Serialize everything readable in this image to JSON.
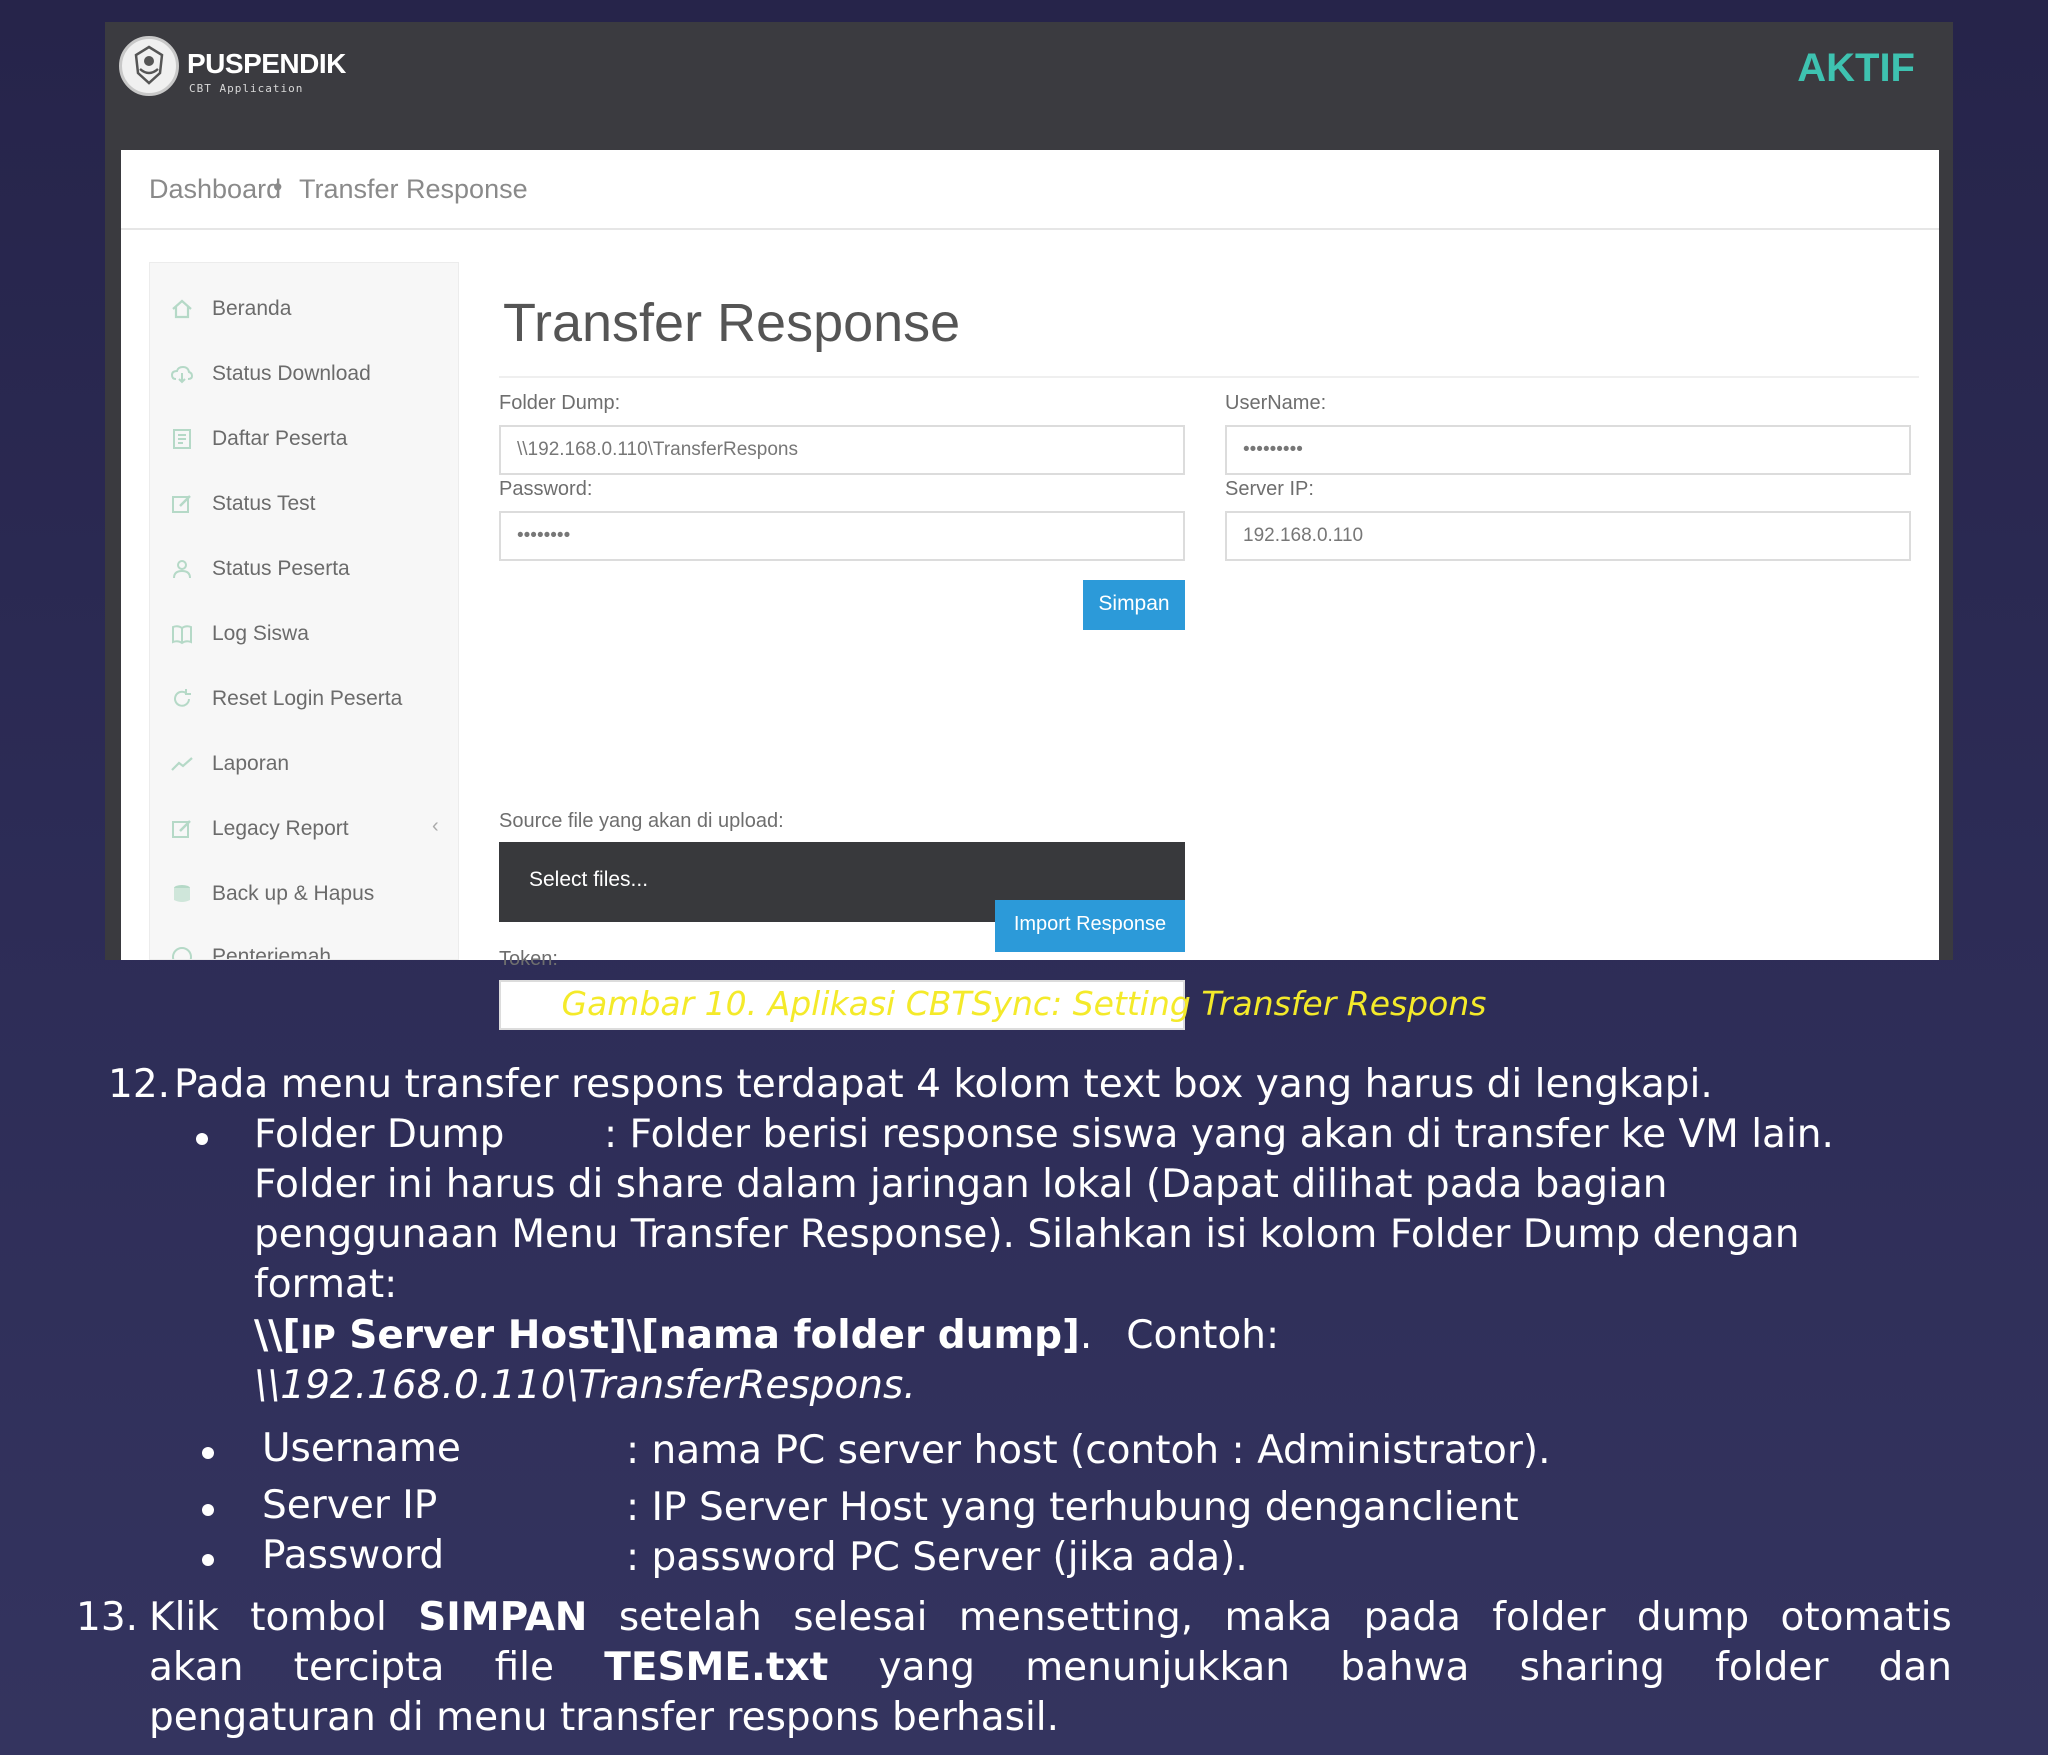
{
  "app": {
    "brand": "PUSPENDIK",
    "brand_sub": "CBT Application",
    "status": "AKTIF"
  },
  "breadcrumb": {
    "items": [
      "Dashboard",
      "Transfer Response"
    ],
    "separator": "•"
  },
  "sidebar": {
    "items": [
      {
        "label": "Beranda",
        "icon": "home-icon"
      },
      {
        "label": "Status Download",
        "icon": "cloud-download-icon"
      },
      {
        "label": "Daftar Peserta",
        "icon": "list-icon"
      },
      {
        "label": "Status Test",
        "icon": "edit-icon"
      },
      {
        "label": "Status Peserta",
        "icon": "user-icon"
      },
      {
        "label": "Log Siswa",
        "icon": "book-icon"
      },
      {
        "label": "Reset Login Peserta",
        "icon": "refresh-icon"
      },
      {
        "label": "Laporan",
        "icon": "chart-line-icon"
      },
      {
        "label": "Legacy Report",
        "icon": "edit-icon",
        "chevron": "‹"
      },
      {
        "label": "Back up & Hapus",
        "icon": "database-icon"
      },
      {
        "label": "Penterjemah",
        "icon": "globe-icon"
      }
    ]
  },
  "form": {
    "title": "Transfer Response",
    "folder_dump": {
      "label": "Folder Dump:",
      "value": "\\\\192.168.0.110\\TransferRespons"
    },
    "password": {
      "label": "Password:",
      "value": "••••••••"
    },
    "username": {
      "label": "UserName:",
      "value": "•••••••••"
    },
    "server_ip": {
      "label": "Server IP:",
      "value": "192.168.0.110"
    },
    "simpan": "Simpan",
    "source_label": "Source file yang akan di upload:",
    "select_files": "Select files...",
    "token": {
      "label": "Token:",
      "value": ""
    },
    "import": "Import Response"
  },
  "caption": "Gambar 10. Aplikasi CBTSync: Setting Transfer Respons",
  "doc": {
    "item12": {
      "num": "12.",
      "text": "Pada menu transfer respons terdapat 4 kolom text box yang harus di  lengkapi."
    },
    "folder": {
      "term": "Folder Dump",
      "desc": ": Folder berisi response siswa yang akan di  transfer ke VM lain.",
      "line2": "Folder ini harus di share dalam jaringan lokal  (Dapat dilihat pada bagian",
      "line3": "penggunaan Menu Transfer Response).  Silahkan isi kolom Folder Dump dengan",
      "line4": "format:",
      "fmt_pre": "\\\\[",
      "fmt_ip": "IP",
      "fmt_rest": " Server Host]\\[nama folder dump]",
      "fmt_dot": ".",
      "contoh": "Contoh:",
      "example": "\\\\192.168.0.110\\TransferRespons."
    },
    "username": {
      "term": "Username",
      "desc": ": nama PC server host (contoh : Administrator)."
    },
    "serverip": {
      "term": "Server IP",
      "desc": ": IP Server Host yang terhubung denganclient"
    },
    "password": {
      "term": "Password",
      "desc": ": password PC Server (jika ada)."
    },
    "item13": {
      "num": "13.",
      "w1": "Klik",
      "w2": "tombol",
      "w3": "SIMPAN",
      "w4": "setelah",
      "w5": "selesai",
      "w6": "mensetting,",
      "w7": "maka",
      "w8": "pada",
      "w9": "folder",
      "w10": "dump",
      "w11": "otomatis",
      "l2w1": "akan",
      "l2w2": "tercipta",
      "l2w3": "file",
      "l2w4": "TESME.txt",
      "l2w5": "yang",
      "l2w6": "menunjukkan",
      "l2w7": "bahwa",
      "l2w8": "sharing",
      "l2w9": "folder",
      "l2w10": "dan",
      "line3": "pengaturan di menu transfer respons  berhasil."
    }
  }
}
